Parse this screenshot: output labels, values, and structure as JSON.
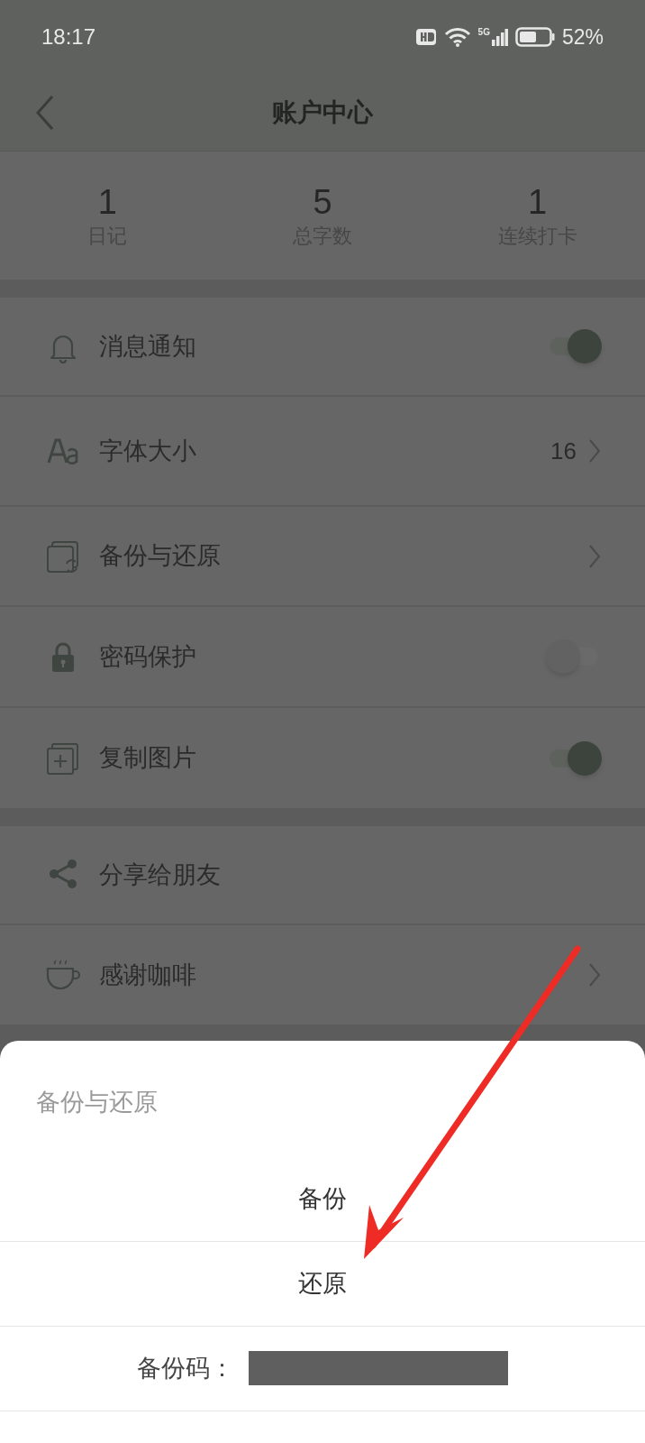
{
  "status_bar": {
    "time": "18:17",
    "network": "5G",
    "battery_text": "52%"
  },
  "header": {
    "title": "账户中心"
  },
  "stats": [
    {
      "value": "1",
      "label": "日记"
    },
    {
      "value": "5",
      "label": "总字数"
    },
    {
      "value": "1",
      "label": "连续打卡"
    }
  ],
  "settings_groups": [
    [
      {
        "kind": "toggle",
        "label": "消息通知",
        "on": true
      },
      {
        "kind": "value",
        "label": "字体大小",
        "value": "16"
      },
      {
        "kind": "link",
        "label": "备份与还原"
      },
      {
        "kind": "toggle",
        "label": "密码保护",
        "on": false
      },
      {
        "kind": "toggle",
        "label": "复制图片",
        "on": true
      }
    ],
    [
      {
        "kind": "plain",
        "label": "分享给朋友"
      },
      {
        "kind": "link",
        "label": "感谢咖啡"
      }
    ]
  ],
  "sheet": {
    "title": "备份与还原",
    "actions": [
      "备份",
      "还原"
    ],
    "backup_code": {
      "label": "备份码：",
      "redacted": true
    }
  }
}
